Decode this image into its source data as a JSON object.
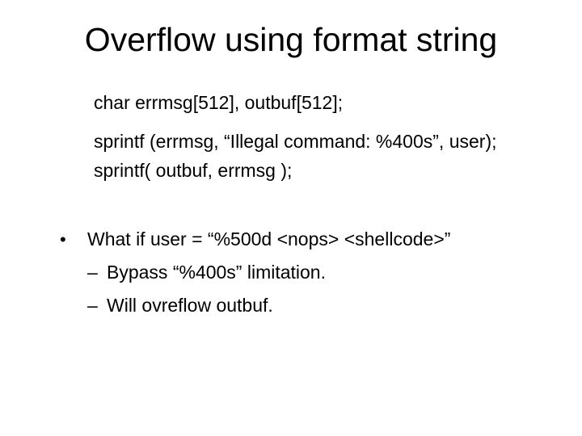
{
  "title": "Overflow using format string",
  "code": {
    "l1": "char errmsg[512],  outbuf[512];",
    "l2": "sprintf (errmsg, “Illegal command: %400s”, user);",
    "l3": "sprintf( outbuf, errmsg );"
  },
  "bullet": {
    "main": "What if   user = “%500d <nops> <shellcode>”",
    "sub1": "Bypass  “%400s”  limitation.",
    "sub2": "Will ovreflow outbuf."
  }
}
